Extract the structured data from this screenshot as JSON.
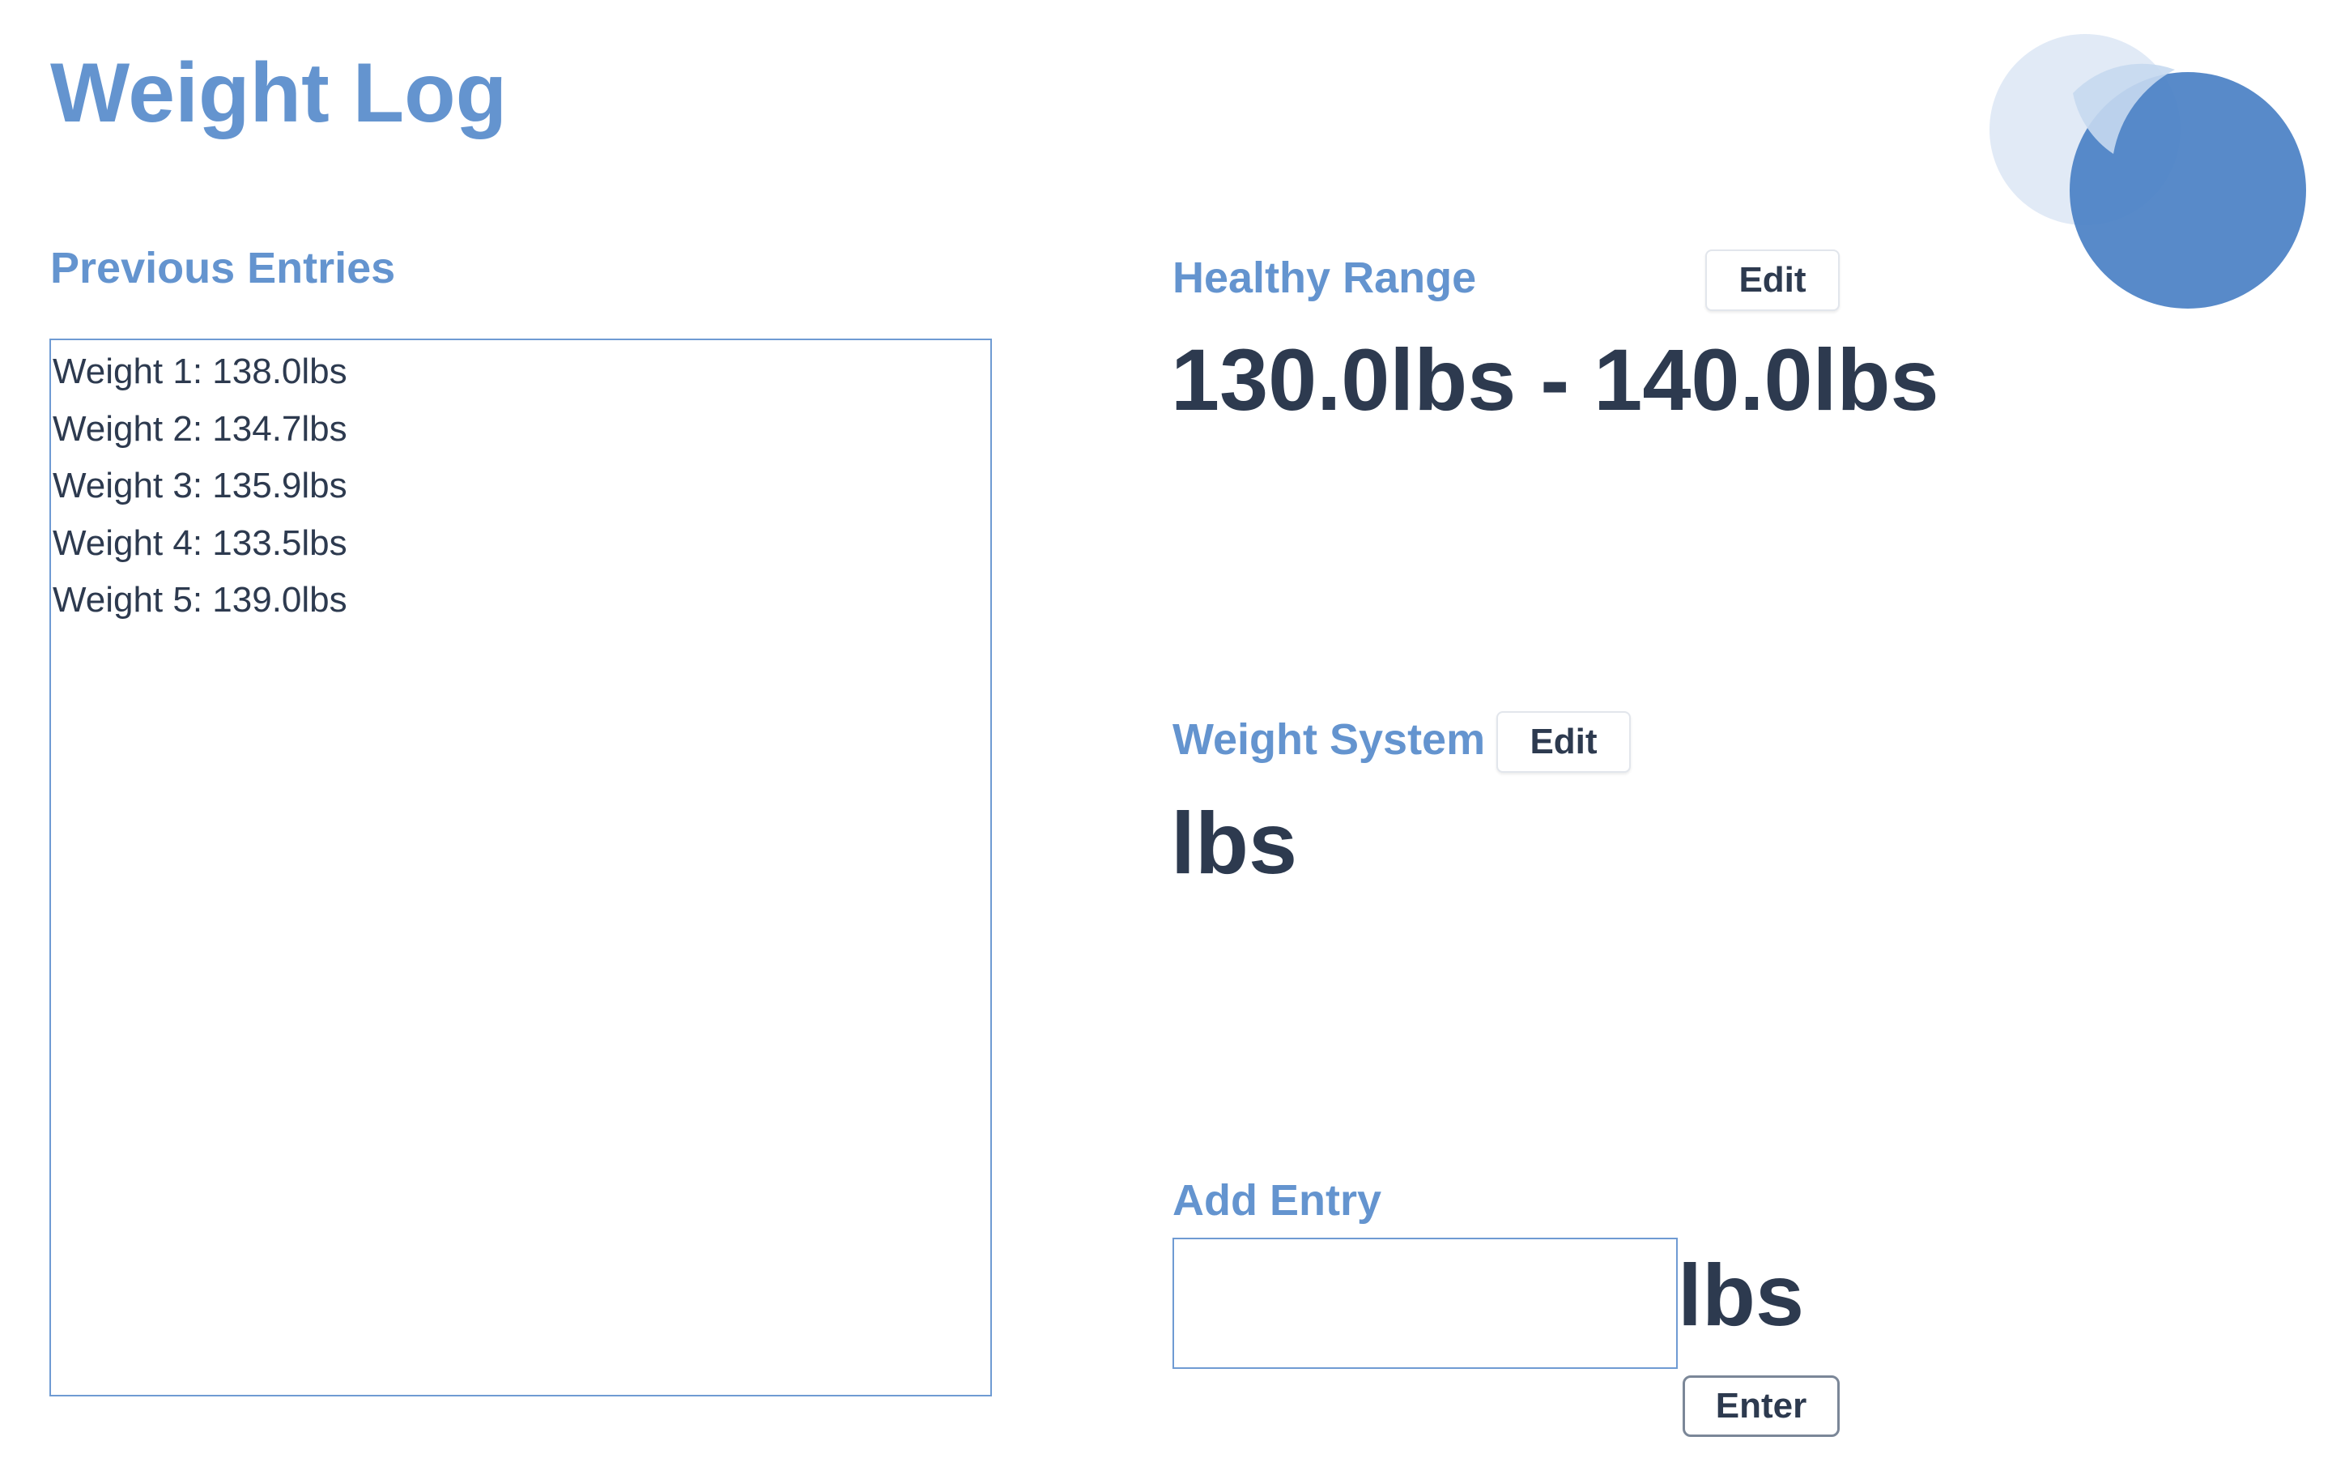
{
  "app": {
    "title": "Weight Log"
  },
  "previous_entries": {
    "heading": "Previous Entries",
    "items": [
      "Weight 1: 138.0lbs",
      "Weight 2: 134.7lbs",
      "Weight 3: 135.9lbs",
      "Weight 4: 133.5lbs",
      "Weight 5: 139.0lbs"
    ]
  },
  "healthy_range": {
    "heading": "Healthy Range",
    "edit_label": "Edit",
    "value": "130.0lbs - 140.0lbs"
  },
  "weight_system": {
    "heading": "Weight System",
    "edit_label": "Edit",
    "value": "lbs"
  },
  "add_entry": {
    "heading": "Add Entry",
    "input_value": "",
    "unit": "lbs",
    "enter_label": "Enter"
  },
  "colors": {
    "accent": "#6494cf",
    "text": "#2d3a4f",
    "border": "#6f9bd3",
    "decor_dark": "#4a80c4",
    "decor_light": "#dfe9f6"
  },
  "icons": {
    "decoration": "overlapping-watercolor-circles"
  }
}
